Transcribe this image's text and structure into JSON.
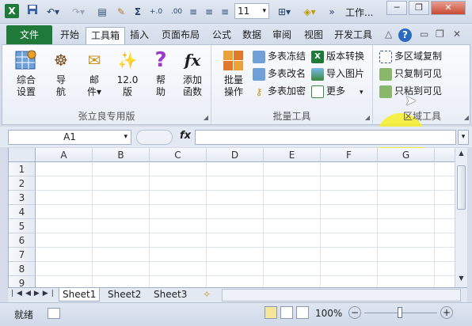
{
  "window": {
    "title": "工作...",
    "app_icon_letter": "X"
  },
  "qat": {
    "font_size_value": "11",
    "sigma": "Σ",
    "decimal_glyph": "+.0",
    "align_glyphs": [
      "≡",
      "≡",
      "≡"
    ],
    "more": "▾"
  },
  "tabs": {
    "file": "文件",
    "items": [
      "开始",
      "工具箱",
      "插入",
      "页面布局",
      "公式",
      "数据",
      "审阅",
      "视图",
      "开发工具"
    ],
    "active": "工具箱"
  },
  "ribbon": {
    "group1": {
      "label": "张立良专用版",
      "buttons": [
        {
          "label_l1": "综合",
          "label_l2": "设置",
          "icon": "settings-grid-icon"
        },
        {
          "label_l1": "导",
          "label_l2": "航",
          "icon": "ship-wheel-icon"
        },
        {
          "label_l1": "邮",
          "label_l2": "件▾",
          "icon": "envelope-icon"
        },
        {
          "label_l1": "12.0",
          "label_l2": "版",
          "icon": "magic-wand-icon"
        },
        {
          "label_l1": "帮",
          "label_l2": "助",
          "icon": "question-icon"
        },
        {
          "label_l1": "添加",
          "label_l2": "函数",
          "icon": "fx-icon"
        }
      ]
    },
    "group2": {
      "label": "批量工具",
      "big": {
        "label_l1": "批量",
        "label_l2": "操作",
        "icon": "grid-color-icon"
      },
      "small": [
        {
          "label": "多表冻结",
          "icon": "grid-icon"
        },
        {
          "label": "多表改名",
          "icon": "grid-icon"
        },
        {
          "label": "多表加密",
          "icon": "key-icon"
        },
        {
          "label": "版本转换",
          "icon": "excel-icon"
        },
        {
          "label": "导入图片",
          "icon": "picture-icon"
        },
        {
          "label": "更多",
          "icon": "page-icon"
        }
      ]
    },
    "group3": {
      "label": "区域工具",
      "small": [
        {
          "label": "多区域复制",
          "icon": "region-icon"
        },
        {
          "label": "只复制可见",
          "icon": "copy-icon"
        },
        {
          "label": "只粘到可见",
          "icon": "paste-icon"
        }
      ]
    }
  },
  "formula_bar": {
    "name_box": "A1",
    "fx": "fx",
    "value": ""
  },
  "grid": {
    "columns": [
      "A",
      "B",
      "C",
      "D",
      "E",
      "F",
      "G"
    ],
    "rows": [
      "1",
      "2",
      "3",
      "4",
      "5",
      "6",
      "7",
      "8",
      "9"
    ]
  },
  "sheets": {
    "tabs": [
      "Sheet1",
      "Sheet2",
      "Sheet3"
    ],
    "active": "Sheet1"
  },
  "status": {
    "mode": "就绪",
    "zoom": "100%",
    "minus": "−",
    "plus": "+"
  },
  "colors": {
    "file_tab": "#1f7a3a",
    "highlight": "#f7f028"
  }
}
